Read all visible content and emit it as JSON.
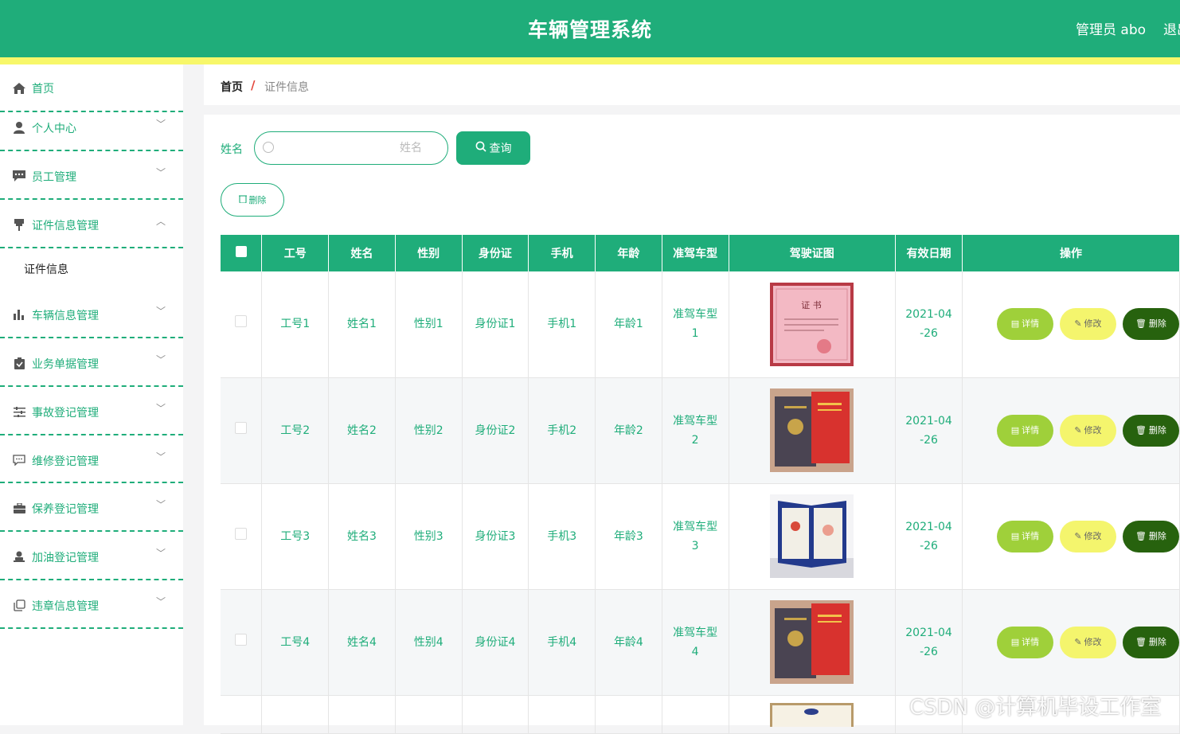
{
  "header": {
    "title": "车辆管理系统",
    "user": "管理员 abo",
    "logout": "退出"
  },
  "sidebar": {
    "items": [
      {
        "label": "首页",
        "icon": "home-icon"
      },
      {
        "label": "个人中心",
        "icon": "user-icon"
      },
      {
        "label": "员工管理",
        "icon": "chat-icon"
      },
      {
        "label": "证件信息管理",
        "icon": "pin-icon"
      },
      {
        "label": "车辆信息管理",
        "icon": "bar-chart-icon"
      },
      {
        "label": "业务单据管理",
        "icon": "clipboard-icon"
      },
      {
        "label": "事故登记管理",
        "icon": "sliders-icon"
      },
      {
        "label": "维修登记管理",
        "icon": "message-icon"
      },
      {
        "label": "保养登记管理",
        "icon": "briefcase-icon"
      },
      {
        "label": "加油登记管理",
        "icon": "person-icon"
      },
      {
        "label": "违章信息管理",
        "icon": "copy-icon"
      }
    ],
    "submenu": "证件信息"
  },
  "breadcrumb": {
    "home": "首页",
    "separator": "/",
    "current": "证件信息"
  },
  "search": {
    "label": "姓名",
    "placeholder": "姓名",
    "query_label": "查询",
    "delete_label": "删除"
  },
  "table": {
    "headers": [
      "工号",
      "姓名",
      "性别",
      "身份证",
      "手机",
      "年龄",
      "准驾车型",
      "驾驶证图",
      "有效日期",
      "操作"
    ],
    "rows": [
      {
        "gonghao": "工号1",
        "name": "姓名1",
        "gender": "性别1",
        "idcard": "身份证1",
        "phone": "手机1",
        "age": "年龄1",
        "cartype1": "准驾车型",
        "cartype2": "1",
        "date1": "2021-04",
        "date2": "-26",
        "cert": "pink"
      },
      {
        "gonghao": "工号2",
        "name": "姓名2",
        "gender": "性别2",
        "idcard": "身份证2",
        "phone": "手机2",
        "age": "年龄2",
        "cartype1": "准驾车型",
        "cartype2": "2",
        "date1": "2021-04",
        "date2": "-26",
        "cert": "booklet"
      },
      {
        "gonghao": "工号3",
        "name": "姓名3",
        "gender": "性别3",
        "idcard": "身份证3",
        "phone": "手机3",
        "age": "年龄3",
        "cartype1": "准驾车型",
        "cartype2": "3",
        "date1": "2021-04",
        "date2": "-26",
        "cert": "blue"
      },
      {
        "gonghao": "工号4",
        "name": "姓名4",
        "gender": "性别4",
        "idcard": "身份证4",
        "phone": "手机4",
        "age": "年龄4",
        "cartype1": "准驾车型",
        "cartype2": "4",
        "date1": "2021-04",
        "date2": "-26",
        "cert": "booklet"
      }
    ],
    "actions": {
      "detail": "详情",
      "edit": "修改",
      "delete": "删除"
    }
  },
  "colors": {
    "primary": "#1fad7a",
    "accent_line": "#f7f76a",
    "detail": "#9fd03a",
    "edit": "#f4f56d",
    "delete": "#27620e"
  },
  "watermark": "CSDN @计算机毕设工作室"
}
